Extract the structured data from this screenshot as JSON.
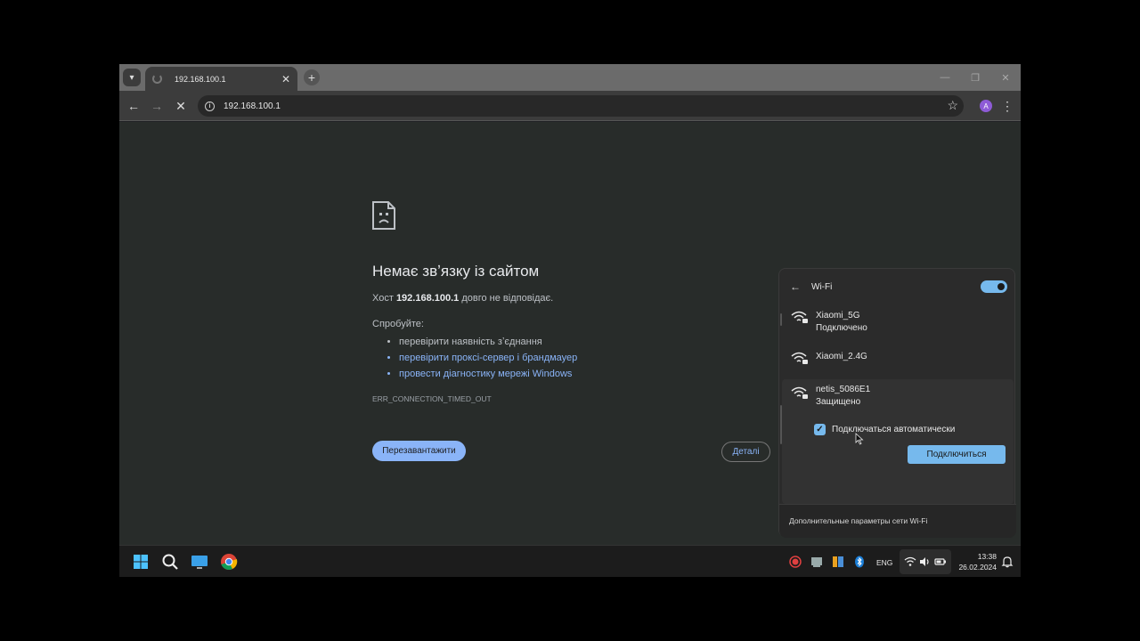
{
  "browser": {
    "tab_title": "192.168.100.1",
    "url": "192.168.100.1",
    "profile_initial": "A"
  },
  "error_page": {
    "title": "Немає звʼязку із сайтом",
    "host_prefix": "Хост ",
    "host": "192.168.100.1",
    "host_suffix": " довго не відповідає.",
    "try_label": "Спробуйте:",
    "suggestions": [
      "перевірити наявність зʼєднання",
      "перевірити проксі-сервер і брандмауер",
      "провести діагностику мережі Windows"
    ],
    "error_code": "ERR_CONNECTION_TIMED_OUT",
    "reload_label": "Перезавантажити",
    "details_label": "Деталі"
  },
  "wifi_panel": {
    "title": "Wi-Fi",
    "enabled": true,
    "networks": [
      {
        "name": "Xiaomi_5G",
        "status": "Подключено"
      },
      {
        "name": "Xiaomi_2.4G",
        "status": ""
      },
      {
        "name": "netis_5086E1",
        "status": "Защищено"
      }
    ],
    "auto_connect_label": "Подключаться автоматически",
    "auto_connect_checked": true,
    "connect_label": "Подключиться",
    "more_settings_label": "Дополнительные параметры сети Wi-Fi"
  },
  "taskbar": {
    "language": "ENG",
    "time": "13:38",
    "date": "26.02.2024"
  },
  "colors": {
    "accent": "#76b9ed",
    "link": "#8ab4f8",
    "page_bg": "#282c2a"
  }
}
